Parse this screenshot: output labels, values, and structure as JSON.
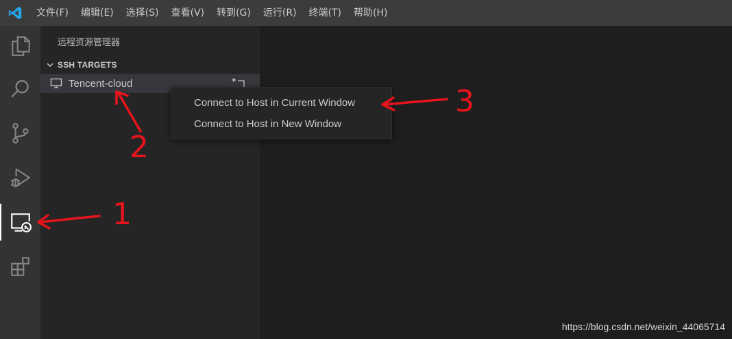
{
  "menubar": {
    "items": [
      "文件(F)",
      "编辑(E)",
      "选择(S)",
      "查看(V)",
      "转到(G)",
      "运行(R)",
      "终端(T)",
      "帮助(H)"
    ]
  },
  "activitybar": {
    "icons": [
      "explorer-icon",
      "search-icon",
      "source-control-icon",
      "run-debug-icon",
      "remote-explorer-icon",
      "extensions-icon"
    ],
    "active": "remote-explorer-icon"
  },
  "sidebar": {
    "title": "远程资源管理器",
    "section": "SSH TARGETS",
    "host": "Tencent-cloud"
  },
  "context_menu": {
    "items": [
      "Connect to Host in Current Window",
      "Connect to Host in New Window"
    ]
  },
  "annotations": {
    "labels": [
      "1",
      "2",
      "3"
    ],
    "color": "#e8141c"
  },
  "watermark": "https://blog.csdn.net/weixin_44065714",
  "colors": {
    "titlebar": "#3c3c3c",
    "activitybar": "#333333",
    "sidebar": "#252526",
    "editor": "#1e1e1e",
    "selection": "#37373d",
    "vscode_blue": "#23a9f2"
  }
}
